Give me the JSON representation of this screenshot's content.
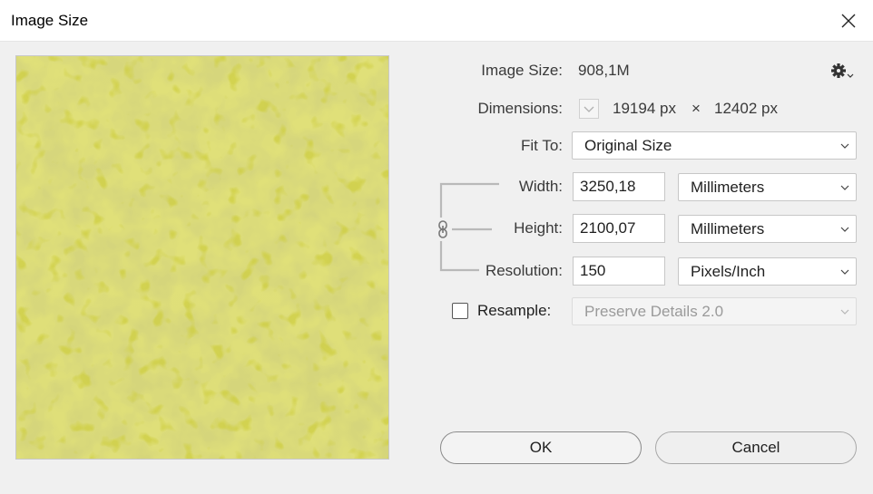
{
  "window": {
    "title": "Image Size"
  },
  "info": {
    "image_size_label": "Image Size:",
    "image_size_value": "908,1M",
    "dimensions_label": "Dimensions:",
    "dim_width": "19194 px",
    "dim_times": "×",
    "dim_height": "12402 px"
  },
  "fit_to": {
    "label": "Fit To:",
    "value": "Original Size"
  },
  "width": {
    "label": "Width:",
    "value": "3250,18",
    "unit": "Millimeters"
  },
  "height": {
    "label": "Height:",
    "value": "2100,07",
    "unit": "Millimeters"
  },
  "resolution": {
    "label": "Resolution:",
    "value": "150",
    "unit": "Pixels/Inch"
  },
  "resample": {
    "label": "Resample:",
    "checked": false,
    "method": "Preserve Details 2.0"
  },
  "buttons": {
    "ok": "OK",
    "cancel": "Cancel"
  },
  "icons": {
    "settings": "gear-icon",
    "close": "close-icon",
    "link": "chain-link-icon",
    "chevron": "chevron-down-icon"
  },
  "colors": {
    "preview_base": "#c8c832",
    "preview_light": "#d9d98a",
    "preview_dark": "#a7a80f"
  }
}
